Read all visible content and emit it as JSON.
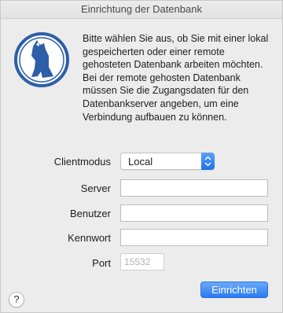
{
  "window": {
    "title": "Einrichtung der Datenbank"
  },
  "intro": {
    "text": "Bitte wählen Sie aus, ob Sie mit einer lokal gespeicherten oder einer remote gehosteten Datenbank arbeiten möchten. Bei der remote gehosten Datenbank müssen Sie die Zugangsdaten für den Datenbankserver angeben, um eine Verbindung aufbauen zu können."
  },
  "form": {
    "client_mode_label": "Clientmodus",
    "client_mode_value": "Local",
    "server_label": "Server",
    "server_value": "",
    "user_label": "Benutzer",
    "user_value": "",
    "password_label": "Kennwort",
    "password_value": "",
    "port_label": "Port",
    "port_placeholder": "15532"
  },
  "actions": {
    "submit_label": "Einrichten",
    "help_label": "?"
  },
  "icons": {
    "logo": "dog-logo-icon",
    "stepper": "up-down-stepper-icon",
    "help": "help-icon"
  },
  "colors": {
    "logo_blue": "#2d5ea8",
    "accent": "#2a7bf0"
  }
}
